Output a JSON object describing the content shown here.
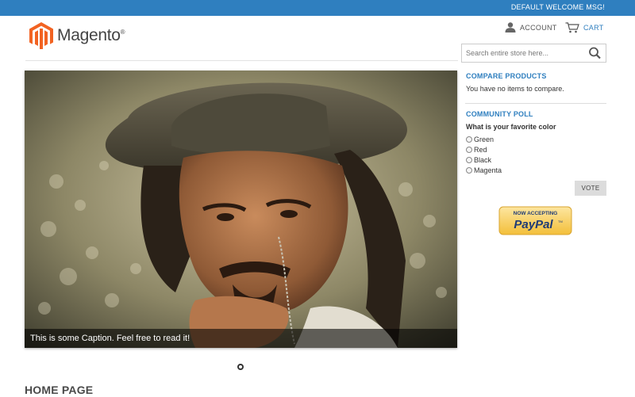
{
  "header": {
    "welcome_msg": "DEFAULT WELCOME MSG!",
    "logo_text": "Magento",
    "logo_mark": "®",
    "account_label": "ACCOUNT",
    "cart_label": "CART",
    "search_placeholder": "Search entire store here..."
  },
  "slider": {
    "caption": "This is some Caption. Feel free to read it!",
    "slides_total": 1,
    "active_slide": 1
  },
  "main": {
    "page_title": "HOME PAGE"
  },
  "sidebar": {
    "compare": {
      "title": "COMPARE PRODUCTS",
      "empty_text": "You have no items to compare."
    },
    "poll": {
      "title": "COMMUNITY POLL",
      "question": "What is your favorite color",
      "options": [
        "Green",
        "Red",
        "Black",
        "Magenta"
      ],
      "vote_label": "VOTE"
    },
    "paypal": {
      "line1": "NOW ACCEPTING",
      "line2": "PayPal",
      "mark": "TM"
    }
  },
  "colors": {
    "brand_blue": "#2f7fbf",
    "logo_orange": "#f26322",
    "paypal_gold": "#f9d26b"
  },
  "icons": {
    "account": "user-icon",
    "cart": "cart-icon",
    "search": "search-icon"
  }
}
